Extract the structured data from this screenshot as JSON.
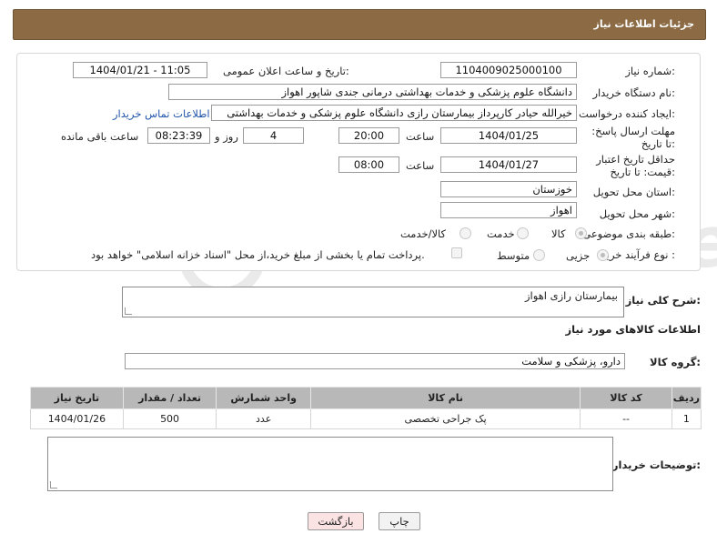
{
  "header": {
    "title": "جزئیات اطلاعات نیاز"
  },
  "form": {
    "need_number_label": "شماره نیاز:",
    "need_number": "1104009025000100",
    "announce_label": "تاریخ و ساعت اعلان عمومی:",
    "announce_value": "1404/01/21 - 11:05",
    "buyer_org_label": "نام دستگاه خریدار:",
    "buyer_org": "دانشگاه علوم پزشکی و خدمات بهداشتی درمانی جندی شاپور اهواز",
    "creator_label": "ایجاد کننده درخواست:",
    "creator": "خیرالله حیادر کارپرداز بیمارستان رازی  دانشگاه علوم پزشکی و خدمات بهداشتی",
    "contact_link": "اطلاعات تماس خریدار",
    "reply_deadline_label": "مهلت ارسال پاسخ: تا تاریخ:",
    "reply_date": "1404/01/25",
    "time_label": "ساعت",
    "reply_time": "20:00",
    "days_value": "4",
    "days_label": "روز و",
    "remaining_time": "08:23:39",
    "remaining_label": "ساعت باقی مانده",
    "price_validity_label": "حداقل تاریخ اعتبار قیمت: تا تاریخ:",
    "price_date": "1404/01/27",
    "price_time": "08:00",
    "province_label": "استان محل تحویل:",
    "province": "خوزستان",
    "city_label": "شهر محل تحویل:",
    "city": "اهواز",
    "category_label": "طبقه بندی موضوعی:",
    "category_options": [
      "کالا",
      "خدمت",
      "کالا/خدمت"
    ],
    "process_label": "نوع فرآیند خرید :",
    "process_options": [
      "جزیی",
      "متوسط"
    ],
    "payment_note": "پرداخت تمام یا بخشی از مبلغ خرید،از محل \"اسناد خزانه اسلامی\" خواهد بود."
  },
  "summary": {
    "label": "شرح کلی نیاز:",
    "value": "بیمارستان رازی اهواز"
  },
  "goods_section": {
    "title": "اطلاعات کالاهای مورد نیاز"
  },
  "goods_group": {
    "label": "گروه کالا:",
    "value": "دارو، پزشکی و سلامت"
  },
  "table": {
    "headers": [
      "ردیف",
      "کد کالا",
      "نام کالا",
      "واحد شمارش",
      "تعداد / مقدار",
      "تاریخ نیاز"
    ],
    "rows": [
      [
        "1",
        "--",
        "پک جراحی تخصصی",
        "عدد",
        "500",
        "1404/01/26"
      ]
    ]
  },
  "buyer_notes": {
    "label": "توضیحات خریدار:",
    "value": ""
  },
  "buttons": {
    "print": "چاپ",
    "back": "بازگشت"
  },
  "watermark": "AriaTender.neT"
}
